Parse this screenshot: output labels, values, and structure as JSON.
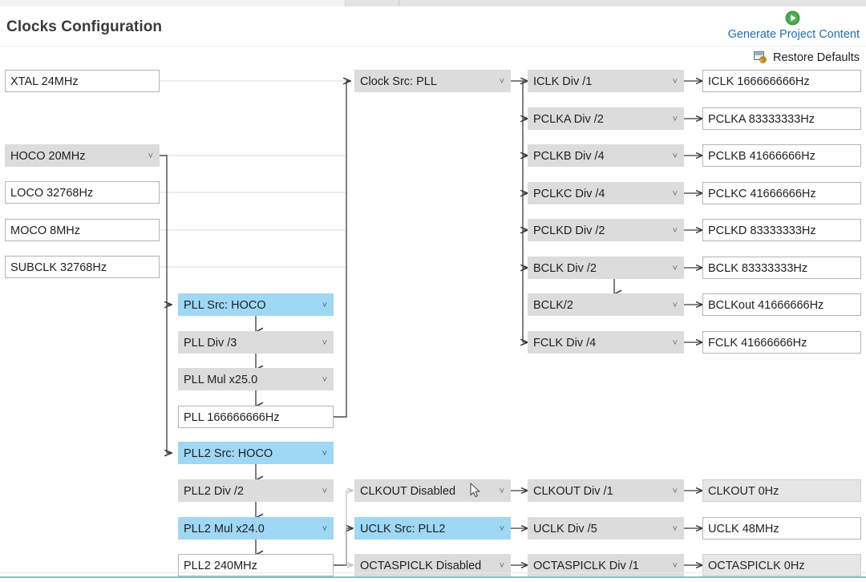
{
  "window": {
    "title": "Clocks Configuration"
  },
  "header": {
    "generate_label": "Generate Project Content",
    "generate_icon": "play-circle-icon",
    "restore_label": "Restore Defaults",
    "restore_icon": "restore-defaults-icon"
  },
  "colors": {
    "accent_link": "#1f6fb5",
    "selected": "#9ed8f5",
    "combo": "#dcdcdc",
    "value_border": "#b4b4b4",
    "bottom_rule": "#7fc6c6",
    "play_green": "#3fa13f"
  },
  "sources": [
    {
      "label": "XTAL 24MHz",
      "type": "value",
      "state": "normal"
    },
    {
      "label": "HOCO 20MHz",
      "type": "combo",
      "state": "normal"
    },
    {
      "label": "LOCO 32768Hz",
      "type": "value",
      "state": "normal"
    },
    {
      "label": "MOCO 8MHz",
      "type": "value",
      "state": "normal"
    },
    {
      "label": "SUBCLK 32768Hz",
      "type": "value",
      "state": "normal"
    }
  ],
  "pll": [
    {
      "label": "PLL Src: HOCO",
      "type": "combo",
      "state": "selected"
    },
    {
      "label": "PLL Div /3",
      "type": "combo",
      "state": "normal"
    },
    {
      "label": "PLL Mul x25.0",
      "type": "combo",
      "state": "normal"
    },
    {
      "label": "PLL 166666666Hz",
      "type": "value",
      "state": "normal"
    }
  ],
  "pll2": [
    {
      "label": "PLL2 Src: HOCO",
      "type": "combo",
      "state": "selected"
    },
    {
      "label": "PLL2 Div /2",
      "type": "combo",
      "state": "normal"
    },
    {
      "label": "PLL2 Mul x24.0",
      "type": "combo",
      "state": "selected"
    },
    {
      "label": "PLL2 240MHz",
      "type": "value",
      "state": "normal"
    }
  ],
  "clock_src": {
    "label": "Clock Src: PLL",
    "type": "combo",
    "state": "normal"
  },
  "dividers": [
    {
      "label": "ICLK Div /1",
      "type": "combo",
      "state": "normal"
    },
    {
      "label": "PCLKA Div /2",
      "type": "combo",
      "state": "normal"
    },
    {
      "label": "PCLKB Div /4",
      "type": "combo",
      "state": "normal"
    },
    {
      "label": "PCLKC Div /4",
      "type": "combo",
      "state": "normal"
    },
    {
      "label": "PCLKD Div /2",
      "type": "combo",
      "state": "normal"
    },
    {
      "label": "BCLK Div /2",
      "type": "combo",
      "state": "normal"
    },
    {
      "label": "BCLK/2",
      "type": "combo",
      "state": "normal"
    },
    {
      "label": "FCLK Div /4",
      "type": "combo",
      "state": "normal"
    }
  ],
  "outputs": [
    {
      "label": "ICLK 166666666Hz",
      "type": "value",
      "state": "normal"
    },
    {
      "label": "PCLKA 83333333Hz",
      "type": "value",
      "state": "normal"
    },
    {
      "label": "PCLKB 41666666Hz",
      "type": "value",
      "state": "normal"
    },
    {
      "label": "PCLKC 41666666Hz",
      "type": "value",
      "state": "normal"
    },
    {
      "label": "PCLKD 83333333Hz",
      "type": "value",
      "state": "normal"
    },
    {
      "label": "BCLK 83333333Hz",
      "type": "value",
      "state": "normal"
    },
    {
      "label": "BCLKout 41666666Hz",
      "type": "value",
      "state": "normal"
    },
    {
      "label": "FCLK 41666666Hz",
      "type": "value",
      "state": "normal"
    }
  ],
  "peripherals": [
    {
      "src": {
        "label": "CLKOUT Disabled",
        "type": "combo",
        "state": "normal"
      },
      "div": {
        "label": "CLKOUT Div /1",
        "type": "combo",
        "state": "normal"
      },
      "out": {
        "label": "CLKOUT 0Hz",
        "type": "value",
        "state": "disabled"
      }
    },
    {
      "src": {
        "label": "UCLK Src: PLL2",
        "type": "combo",
        "state": "selected"
      },
      "div": {
        "label": "UCLK Div /5",
        "type": "combo",
        "state": "normal"
      },
      "out": {
        "label": "UCLK 48MHz",
        "type": "value",
        "state": "normal"
      }
    },
    {
      "src": {
        "label": "OCTASPICLK Disabled",
        "type": "combo",
        "state": "normal"
      },
      "div": {
        "label": "OCTASPICLK Div /1",
        "type": "combo",
        "state": "normal"
      },
      "out": {
        "label": "OCTASPICLK 0Hz",
        "type": "value",
        "state": "disabled"
      }
    }
  ],
  "pointer": {
    "icon": "mouse-arrow-cursor"
  }
}
